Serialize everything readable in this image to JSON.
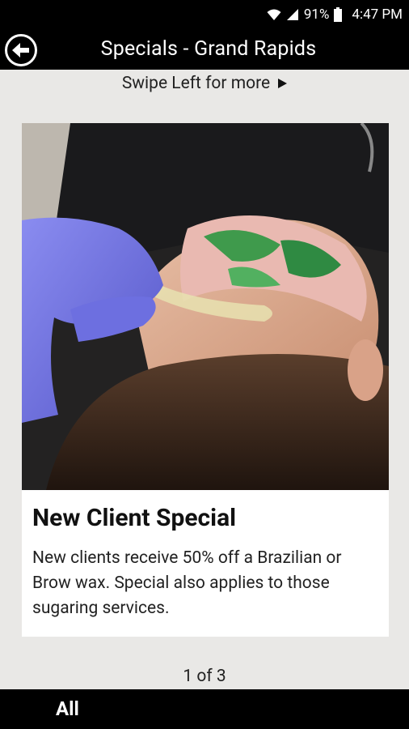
{
  "status_bar": {
    "battery": "91%",
    "time": "4:47 PM",
    "icons": [
      "wifi-icon",
      "signal-icon",
      "battery-icon"
    ]
  },
  "app_bar": {
    "title": "Specials - Grand Rapids",
    "back_icon": "back-arrow-icon"
  },
  "swipe_hint": {
    "text": "Swipe Left for more",
    "icon": "play-triangle-icon"
  },
  "card": {
    "image_alt": "",
    "title": "New Client Special",
    "description": "New clients receive 50% off a Brazilian or Brow wax. Special also applies to those sugaring services."
  },
  "pager": {
    "text": "1 of 3"
  },
  "bottom_bar": {
    "all_label": "All"
  },
  "colors": {
    "bar_background": "#000000",
    "page_background": "#e9e8e6",
    "card_background": "#ffffff"
  }
}
